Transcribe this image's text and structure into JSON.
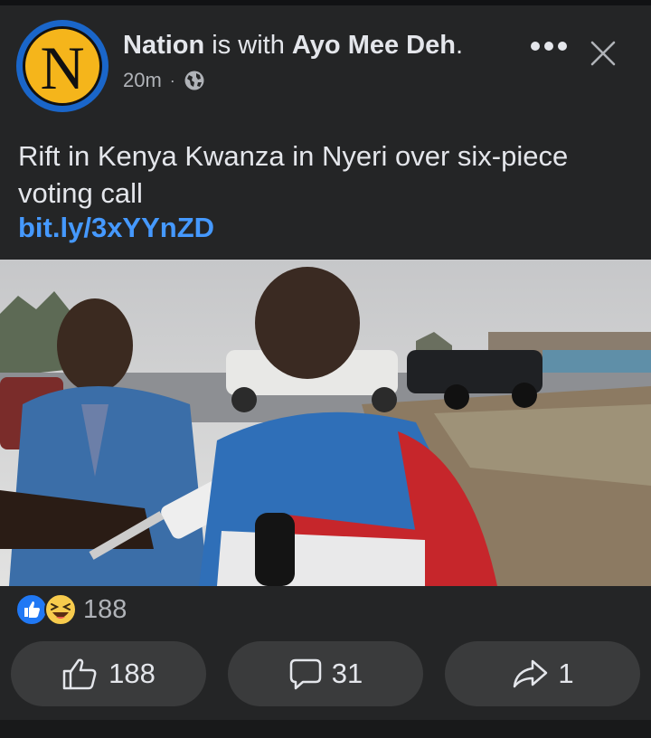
{
  "post": {
    "page_name": "Nation",
    "is_with_text": "is with",
    "tagged_name": "Ayo Mee Deh",
    "headline_end": ".",
    "avatar_letter": "N",
    "time": "20m",
    "separator": "·",
    "privacy_icon": "globe-icon",
    "text": "Rift in Kenya Kwanza in Nyeri over six-piece voting call",
    "link": "bit.ly/3xYYnZD"
  },
  "reactions": {
    "icons": [
      "like-reaction-icon",
      "haha-reaction-icon"
    ],
    "count": "188"
  },
  "actions": {
    "like_count": "188",
    "comment_count": "31",
    "share_count": "1"
  },
  "colors": {
    "background": "#242526",
    "link": "#4599ff",
    "avatar_ring": "#1a66c9",
    "avatar_fill": "#f5b51b",
    "button_bg": "#3a3b3c"
  }
}
